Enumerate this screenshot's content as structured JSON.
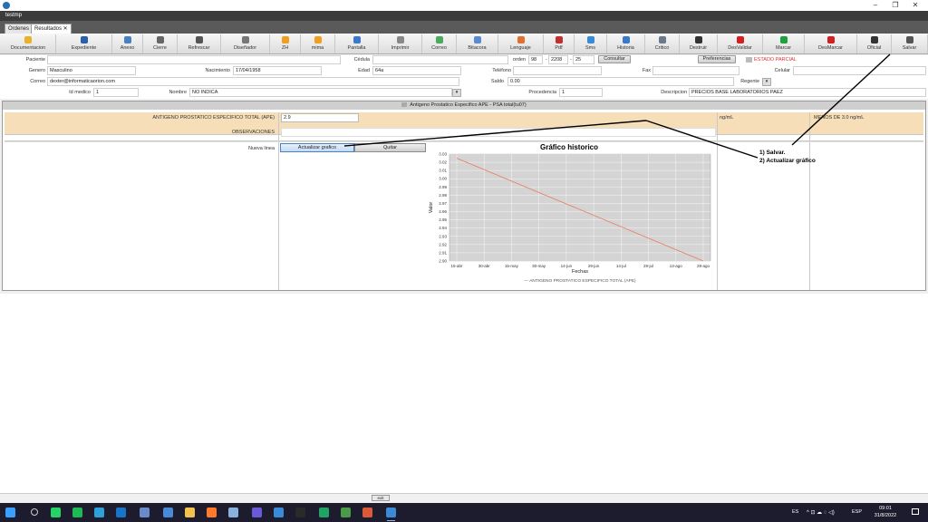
{
  "window": {
    "title": "",
    "app_label": "testmp",
    "minimize": "–",
    "maximize": "❐",
    "close": "✕"
  },
  "tabs": [
    {
      "label": "Ordenes"
    },
    {
      "label": "Resultados ✕"
    }
  ],
  "toolbar": [
    {
      "label": "Documentacion",
      "icon": "documentation-icon",
      "color": "#e8b22b"
    },
    {
      "label": "Expediente",
      "icon": "person-icon",
      "color": "#2b5fa8"
    },
    {
      "label": "Anexo",
      "icon": "attachment-icon",
      "color": "#4a7fc0"
    },
    {
      "label": "Cierre",
      "icon": "lock-icon",
      "color": "#666666"
    },
    {
      "label": "Refrescar",
      "icon": "refresh-icon",
      "color": "#555555"
    },
    {
      "label": "Diseñador",
      "icon": "designer-icon",
      "color": "#777777"
    },
    {
      "label": "ZH",
      "icon": "star-icon",
      "color": "#f0a020"
    },
    {
      "label": "mima",
      "icon": "sun-icon",
      "color": "#f0a020"
    },
    {
      "label": "Pantalla",
      "icon": "screen-icon",
      "color": "#3a7ac8"
    },
    {
      "label": "Imprimir",
      "icon": "printer-icon",
      "color": "#888888"
    },
    {
      "label": "Correo",
      "icon": "mail-icon",
      "color": "#4caa60"
    },
    {
      "label": "Bitacora",
      "icon": "search-icon",
      "color": "#5a8ad0"
    },
    {
      "label": "Lenguaje",
      "icon": "language-icon",
      "color": "#e07030"
    },
    {
      "label": "Pdf",
      "icon": "pdf-icon",
      "color": "#c03030"
    },
    {
      "label": "Sms",
      "icon": "sms-icon",
      "color": "#3a8ad8"
    },
    {
      "label": "Historia",
      "icon": "history-icon",
      "color": "#3a7ac8"
    },
    {
      "label": "Critico",
      "icon": "critical-icon",
      "color": "#6a7a8a"
    },
    {
      "label": "Destruir",
      "icon": "destroy-icon",
      "color": "#333333"
    },
    {
      "label": "DesValidar",
      "icon": "invalidate-icon",
      "color": "#d02020"
    },
    {
      "label": "Marcar",
      "icon": "check-icon",
      "color": "#20a040"
    },
    {
      "label": "DesMarcar",
      "icon": "uncheck-icon",
      "color": "#d02020"
    },
    {
      "label": "Oficial",
      "icon": "pen-icon",
      "color": "#333333"
    },
    {
      "label": "Salvar",
      "icon": "save-icon",
      "color": "#555555"
    }
  ],
  "form": {
    "paciente_label": "Paciente",
    "paciente_value": "",
    "cedula_label": "Cédula",
    "cedula_value": "",
    "orden_label": "orden",
    "orden_1": "98",
    "orden_2": "2208",
    "orden_3": "25",
    "consultar": "Consultar",
    "preferencias": "Preferencias",
    "estado": "ESTADO PARCIAL",
    "genero_label": "Genero",
    "genero_value": "Masculino",
    "nacimiento_label": "Nacimiento",
    "nacimiento_value": "17/04/1958",
    "edad_label": "Edad",
    "edad_value": "64a",
    "telefono_label": "Teléfono",
    "telefono_value": "",
    "fax_label": "Fax",
    "fax_value": "",
    "celular_label": "Celular",
    "celular_value": "",
    "correo_label": "Correo",
    "correo_value": "dexter@informaticaorion.com",
    "saldo_label": "Saldo",
    "saldo_value": "0.00",
    "regente_label": "Regente",
    "regente_value": "",
    "idmedico_label": "Id medico",
    "idmedico_value": "1",
    "nombre_label": "Nombre",
    "nombre_value": "NO INDICA",
    "procedencia_label": "Procedencia",
    "procedencia_value": "1",
    "descripcion_label": "Descripcion",
    "descripcion_value": "PRECIOS BASE LABORATORIOS PAEZ"
  },
  "panel": {
    "header": "Antigeno Prostatico Especifico  APE - PSA total(tu07)",
    "test_name": "ANTIGENO PROSTATICO ESPECIFICO TOTAL (APE)",
    "test_value": "2.9",
    "unit": "ng/mL",
    "reference": "MENOS DE 3.0 ng/mL",
    "observaciones_label": "OBSERVACIONES",
    "observaciones_value": "",
    "nueva_linea_label": "Nueva linea",
    "actualizar_btn": "Actualizar grafico",
    "quitar_btn": "Quitar"
  },
  "annotation": {
    "line1": "1) Salvar.",
    "line2": "2) Actualizar gráfico"
  },
  "chart_data": {
    "type": "line",
    "title": "Gráfico historico",
    "xlabel": "Fechas",
    "ylabel": "Valor",
    "x_ticks": [
      "15-abr",
      "30-abr",
      "15-may",
      "30-may",
      "14-jun",
      "29-jun",
      "14-jul",
      "29-jul",
      "13-ago",
      "28-ago"
    ],
    "y_ticks": [
      "3.03",
      "3.02",
      "3.01",
      "3.00",
      "2.99",
      "2.98",
      "2.97",
      "2.96",
      "2.95",
      "2.94",
      "2.93",
      "2.92",
      "2.91",
      "2.90"
    ],
    "ylim": [
      2.9,
      3.03
    ],
    "grid": true,
    "legend_position": "bottom",
    "series": [
      {
        "name": "— ANTIGENO PROSTATICO ESPECIFICO TOTAL  (APE)",
        "color": "#e8836e",
        "x": [
          "15-abr",
          "28-ago"
        ],
        "values": [
          3.025,
          2.9
        ]
      }
    ]
  },
  "statusbar": {
    "exit": "exit"
  },
  "taskbar": {
    "lang": "ES",
    "kbd": "ESP",
    "time": "09:01",
    "date": "31/8/2022",
    "apps": [
      {
        "name": "start-icon",
        "color": "#3aa0ff"
      },
      {
        "name": "search-icon",
        "color": "#cccccc"
      },
      {
        "name": "whatsapp-icon",
        "color": "#25d366"
      },
      {
        "name": "spotify-icon",
        "color": "#1db954"
      },
      {
        "name": "edge-icon",
        "color": "#2fa0d8"
      },
      {
        "name": "outlook-icon",
        "color": "#1a73c8"
      },
      {
        "name": "app-icon",
        "color": "#6a8ac8"
      },
      {
        "name": "network-icon",
        "color": "#4a88d8"
      },
      {
        "name": "folder-icon",
        "color": "#f2c14e"
      },
      {
        "name": "firefox-icon",
        "color": "#ff7a2a"
      },
      {
        "name": "cube-icon",
        "color": "#8ab0e0"
      },
      {
        "name": "chat-icon",
        "color": "#6a5ad8"
      },
      {
        "name": "media-icon",
        "color": "#3a8ad8"
      },
      {
        "name": "terminal-icon",
        "color": "#2a2a2a"
      },
      {
        "name": "excel-icon",
        "color": "#21a366"
      },
      {
        "name": "ms-icon",
        "color": "#4a9a4a"
      },
      {
        "name": "tiles-icon",
        "color": "#d85a3a"
      },
      {
        "name": "orion-icon",
        "color": "#3a8ad8"
      }
    ]
  }
}
